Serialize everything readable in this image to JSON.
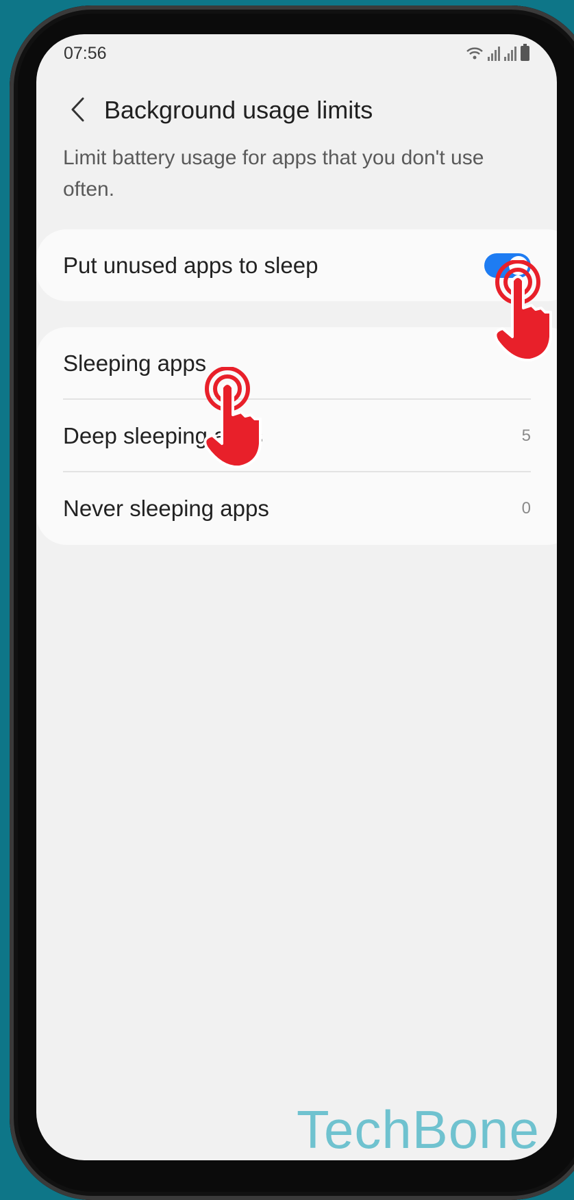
{
  "status_bar": {
    "time": "07:56"
  },
  "header": {
    "title": "Background usage limits"
  },
  "description": "Limit battery usage for apps that you don't use often.",
  "toggle_card": {
    "label": "Put unused apps to sleep",
    "enabled": true
  },
  "list": [
    {
      "label": "Sleeping apps",
      "count": ""
    },
    {
      "label": "Deep sleeping apps",
      "count": "5"
    },
    {
      "label": "Never sleeping apps",
      "count": "0"
    }
  ],
  "watermark": "TechBone",
  "colors": {
    "accent": "#1e7cf2",
    "background": "#0e7688",
    "hand": "#e8202a"
  }
}
